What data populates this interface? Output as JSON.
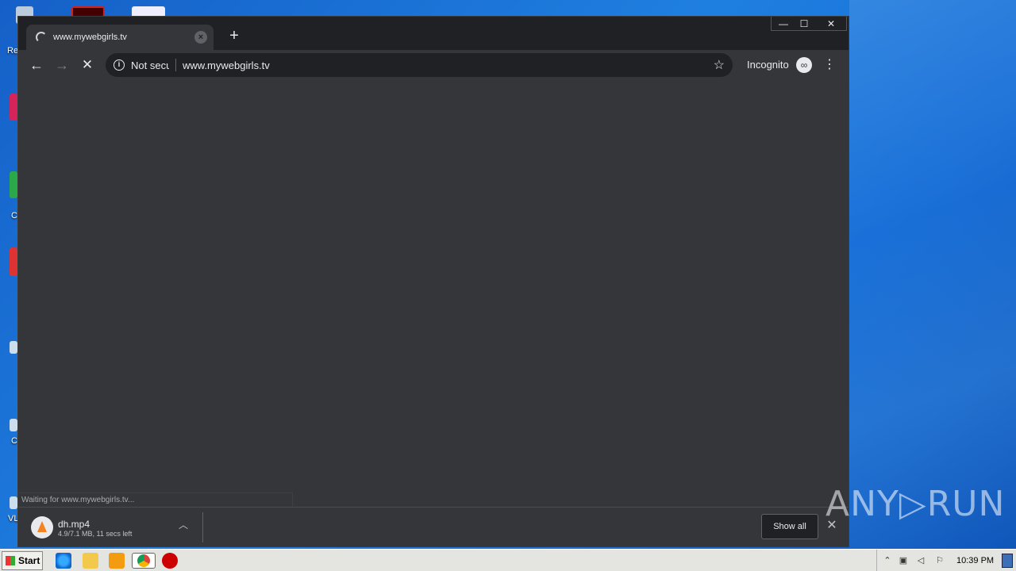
{
  "browser": {
    "tab": {
      "title": "www.mywebgirls.tv"
    },
    "omnibox": {
      "security": "Not secure",
      "url": "www.mywebgirls.tv"
    },
    "incognito_label": "Incognito",
    "status_text": "Waiting for www.mywebgirls.tv...",
    "download": {
      "filename": "dh.mp4",
      "status": "4.9/7.1 MB, 11 secs left"
    },
    "show_all_label": "Show all"
  },
  "desktop": {
    "icon_labels": [
      "Re",
      "C",
      "C",
      "VL"
    ]
  },
  "watermark": "ANY▷RUN",
  "taskbar": {
    "start_label": "Start",
    "clock": "10:39 PM"
  },
  "colors": {
    "chrome_dark": "#202124",
    "chrome_toolbar": "#35363a",
    "desktop_blue": "#1f7fe0"
  }
}
